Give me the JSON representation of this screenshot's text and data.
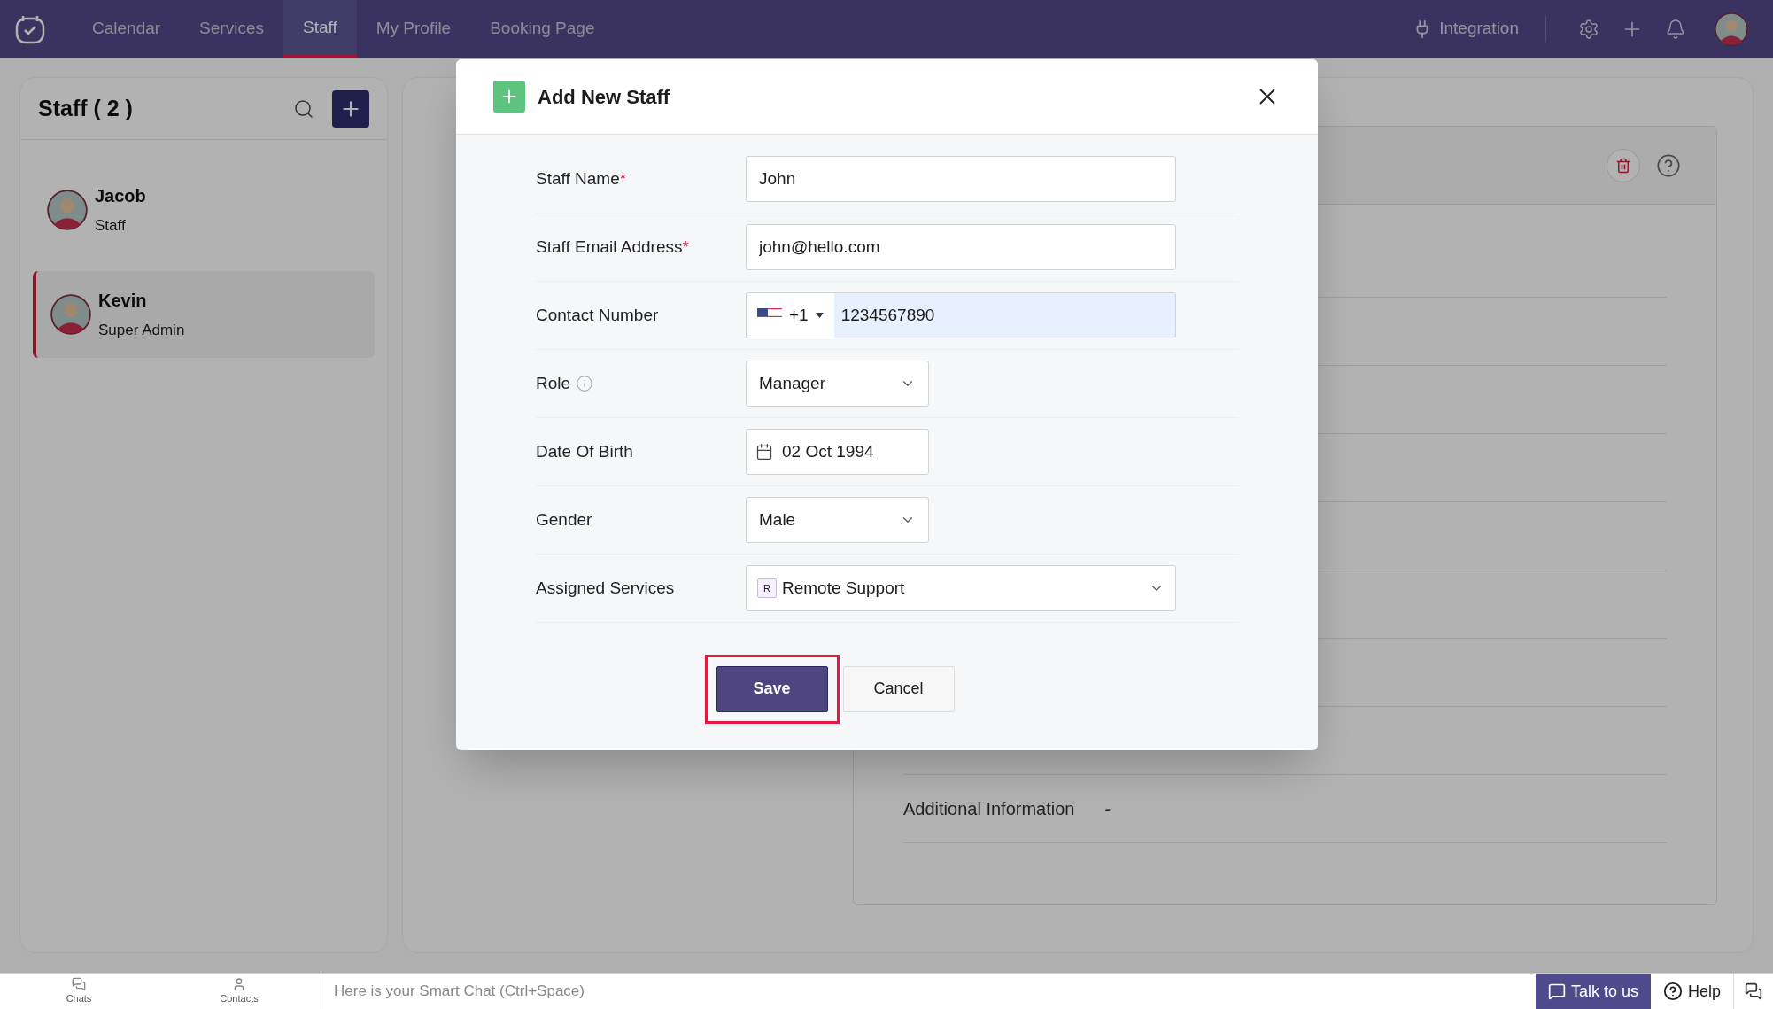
{
  "nav": {
    "tabs": [
      {
        "label": "Calendar",
        "selected": false
      },
      {
        "label": "Services",
        "selected": false
      },
      {
        "label": "Staff",
        "selected": true
      },
      {
        "label": "My Profile",
        "selected": false
      },
      {
        "label": "Booking Page",
        "selected": false
      }
    ],
    "integration": "Integration"
  },
  "staff_panel": {
    "title": "Staff ( 2 )",
    "members": [
      {
        "name": "Jacob",
        "role": "Staff",
        "selected": false
      },
      {
        "name": "Kevin",
        "role": "Super Admin",
        "selected": true
      }
    ]
  },
  "details": {
    "rows": [
      {
        "label": "Additional Information",
        "value": "-"
      }
    ]
  },
  "dialog": {
    "title": "Add New Staff",
    "fields": [
      {
        "kind": "text",
        "label": "Staff Name",
        "required_mark": "*",
        "info": false,
        "value": "John"
      },
      {
        "kind": "text",
        "label": "Staff Email Address",
        "required_mark": "*",
        "info": false,
        "value": "john@hello.com"
      },
      {
        "kind": "phone",
        "label": "Contact Number",
        "info": false,
        "code": "+1",
        "value": "1234567890"
      },
      {
        "kind": "select",
        "label": "Role",
        "info": true,
        "value": "Manager"
      },
      {
        "kind": "date",
        "label": "Date Of Birth",
        "info": false,
        "value": "02 Oct 1994"
      },
      {
        "kind": "select",
        "label": "Gender",
        "info": false,
        "value": "Male"
      },
      {
        "kind": "tags",
        "label": "Assigned Services",
        "info": false,
        "initial": "R",
        "value": "Remote Support"
      }
    ],
    "save": "Save",
    "cancel": "Cancel"
  },
  "bottom_bar": {
    "chats": "Chats",
    "contacts": "Contacts",
    "smart_chat_placeholder": "Here is your Smart Chat (Ctrl+Space)",
    "talk": "Talk to us",
    "help": "Help"
  }
}
